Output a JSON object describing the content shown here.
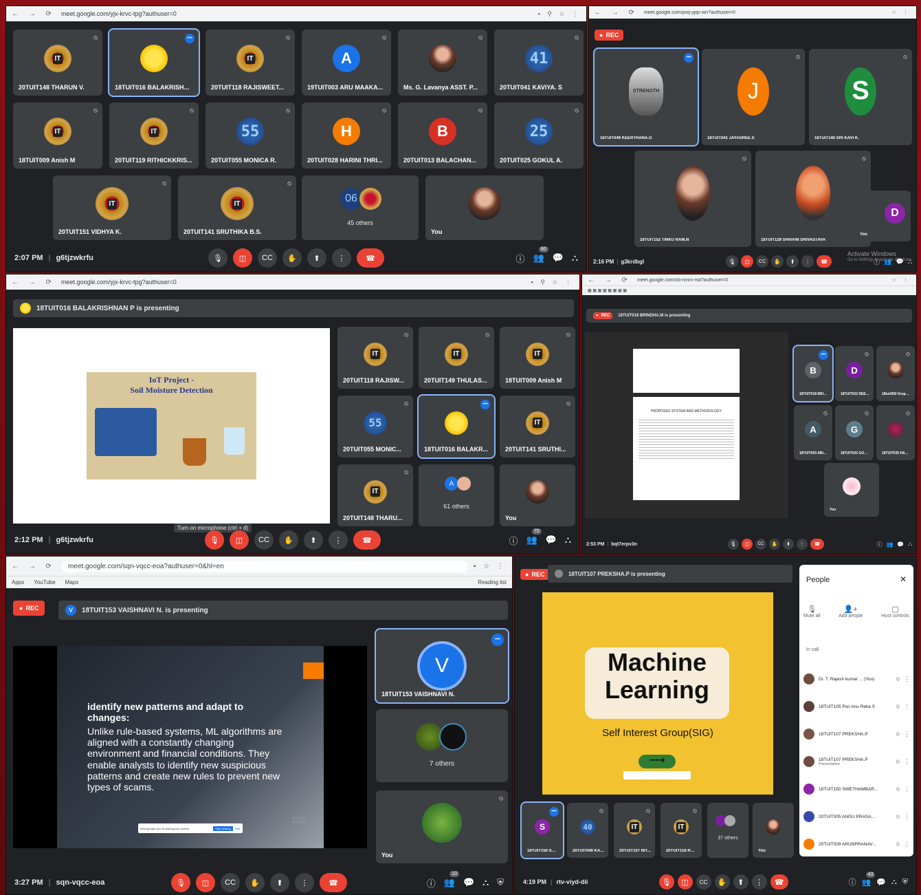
{
  "s1": {
    "url": "meet.google.com/yjx-krvc-tpg?authuser=0",
    "tiles": [
      "20TUIT148 THARUN V.",
      "18TUIT016 BALAKRISH...",
      "20TUIT118 RAJISWEET...",
      "19TUIT003 ARU MAAKA...",
      "Ms. G. Lavanya ASST. P...",
      "20TUIT041 KAVIYA. S",
      "18TUIT009 Anish M",
      "20TUIT119 RITHICKKRIS...",
      "20TUIT055 MONICA R.",
      "20TUIT028 HARINI THRI...",
      "20TUIT013 BALACHAN...",
      "20TUIT025 GOKUL A.",
      "20TUIT151 VIDHYA K.",
      "20TUIT141 SRUTHIKA B.S.",
      "45 others",
      "You"
    ],
    "letters": {
      "aru": "A",
      "harini": "H",
      "bala": "B"
    },
    "nums": {
      "kaviya": "41",
      "monica": "55",
      "gokul": "25",
      "others": "06"
    },
    "time": "2:07 PM",
    "code": "g6tjzwkrfu",
    "people": "60"
  },
  "s2": {
    "url": "meet.google.com/pxq-yjqv-wrr?authuser=0",
    "rec": "REC",
    "tiles": [
      "18TUIT049 KEERTHANA.G",
      "18TUIT041 JAYASREE.S",
      "18TUIT140 SRI KAVI K.",
      "18TUIT152 TINKU RAM.N",
      "18TUIT129 SHIVANI SRIVASTAVA",
      "You"
    ],
    "letters": {
      "j": "J",
      "s": "S",
      "d": "D"
    },
    "quote": "STRENGTH",
    "time": "2:16 PM",
    "code": "g3krdbgl",
    "activate": "Activate Windows",
    "activate_sub": "Go to Settings to activate Windows."
  },
  "s3": {
    "url": "meet.google.com/yjx-krvc-tpg?authuser=0",
    "presenting": "18TUIT016 BALAKRISHNAN P is presenting",
    "slide_title": "IoT Project -",
    "slide_sub": "Soil Moisture Detection",
    "tiles": [
      "20TUIT118 RAJISW...",
      "20TUIT149 THULAS...",
      "18TUIT009 Anish M",
      "20TUIT055 MONIC...",
      "18TUIT016 BALAKR...",
      "20TUIT141 SRUTHI...",
      "20TUIT148 THARU...",
      "61 others",
      "You"
    ],
    "num55": "55",
    "letter_a": "A",
    "tooltip": "Turn on microphone (ctrl + d)",
    "time": "2:12 PM",
    "code": "g6tjzwkrfu",
    "people": "70"
  },
  "s4": {
    "url": "meet.google.com/cb-nmrx-ma?authuser=0",
    "rec": "REC",
    "presenting": "18TUIT018 BRINDHA.M is presenting",
    "doc_heading": "PROPOSED SYSTEM AND METHODOLOGY",
    "tiles": [
      "18TUIT018 BRIND...",
      "18TUIT022 DEEPIK...",
      "18tuit050 Krupasr...",
      "18TUIT003 ABINE...",
      "18TUIT033 GOKU...",
      "18TUIT035 HAME...",
      "You"
    ],
    "letters": {
      "b": "B",
      "d": "D",
      "a": "A",
      "g": "G"
    },
    "time": "2:53 PM",
    "code": "bqt7erpv3n"
  },
  "s5": {
    "url": "meet.google.com/sqn-vqcc-eoa?authuser=0&hl=en",
    "bookmarks": [
      "Apps",
      "YouTube",
      "Maps"
    ],
    "reading": "Reading list",
    "rec": "REC",
    "presenting": "18TUIT153 VAISHNAVI N. is presenting",
    "letter_v": "V",
    "bullet_head": "identify new patterns and adapt to changes:",
    "bullet_body": "Unlike rule-based systems, ML algorithms are aligned with a constantly changing environment and financial conditions. They enable analysts to identify new suspicious patterns and create new rules to prevent new types of scams.",
    "share_text": "meet.google.com is sharing your screen.",
    "stop_sharing": "Stop sharing",
    "hide": "Hide",
    "activate": "Activate Windows",
    "tiles": [
      "18TUIT153 VAISHNAVI N.",
      "7 others",
      "You"
    ],
    "time": "3:27 PM",
    "code": "sqn-vqcc-eoa",
    "people": "10"
  },
  "s6": {
    "rec": "REC",
    "presenting": "18TUIT107 PREKSHA.P is presenting",
    "slide_title1": "Machine",
    "slide_title2": "Learning",
    "slide_sub": "Self Interest Group(SIG)",
    "tiles": [
      "18TUIT150 SWE...",
      "20TUIT040 KA...",
      "20TUIT107 NIT...",
      "20TUIT118 RAJI...",
      "37 others",
      "You"
    ],
    "num40": "40",
    "people_panel": {
      "title": "People",
      "actions": [
        "Mute all",
        "Add people",
        "Host controls"
      ],
      "section": "In call",
      "list": [
        {
          "name": "Dr. T. Rajesh kumar ... (You)",
          "sub": ""
        },
        {
          "name": "18TUIT105 Pon Anu Reka S",
          "sub": ""
        },
        {
          "name": "18TUIT107 PREKSHA.P",
          "sub": ""
        },
        {
          "name": "18TUIT107 PREKSHA.P",
          "sub": "Presentation"
        },
        {
          "name": "18TUIT150 SWETHAMBAR...",
          "sub": ""
        },
        {
          "name": "20TUIT005 ANGU PRASA...",
          "sub": ""
        },
        {
          "name": "20TUIT009 ARUNPRANAV...",
          "sub": ""
        }
      ]
    },
    "time": "4:19 PM",
    "code": "rtv-viyd-dii",
    "people": "43"
  }
}
